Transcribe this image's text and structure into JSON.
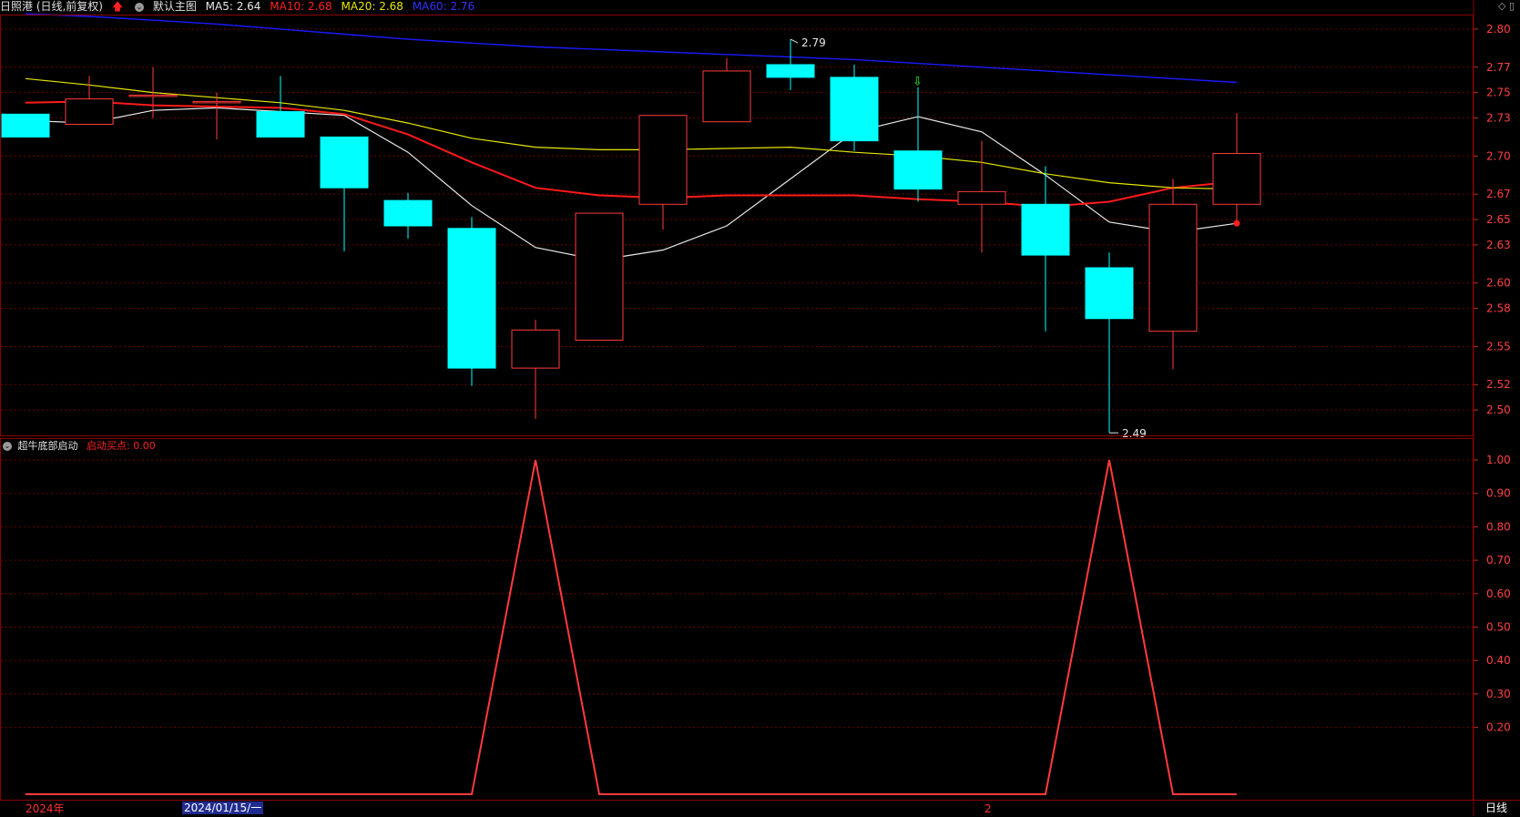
{
  "header": {
    "stock": "日照港 (日线,前复权)",
    "template": "默认主图",
    "ma5": "MA5: 2.64",
    "ma10": "MA10: 2.68",
    "ma20": "MA20: 2.68",
    "ma60": "MA60: 2.76"
  },
  "indicator": {
    "name": "超牛底部启动",
    "value_label": "启动买点: 0.00"
  },
  "bottom": {
    "year_label": "2024年",
    "cursor_date": "2024/01/15/一",
    "month_label": "2",
    "period": "日线"
  },
  "colors": {
    "up": "#ff3b3b",
    "down": "#00ffff",
    "ma5": "#e8e8e8",
    "ma10": "#ff1a1a",
    "ma20": "#e6e600",
    "ma60": "#1a1aff",
    "grid": "#6b0000",
    "axis_text": "#ff4040"
  },
  "chart_data": [
    {
      "type": "candlestick",
      "y_ticks": [
        "2.80",
        "2.77",
        "2.75",
        "2.73",
        "2.70",
        "2.67",
        "2.65",
        "2.63",
        "2.60",
        "2.58",
        "2.55",
        "2.52",
        "2.50"
      ],
      "ylim": [
        2.48,
        2.81
      ],
      "annotations": {
        "high": "2.79",
        "low": "2.49"
      },
      "candles": [
        {
          "o": 2.733,
          "c": 2.715,
          "h": 2.733,
          "l": 2.715
        },
        {
          "o": 2.725,
          "c": 2.745,
          "h": 2.763,
          "l": 2.725
        },
        {
          "o": 2.748,
          "c": 2.748,
          "h": 2.77,
          "l": 2.73
        },
        {
          "o": 2.743,
          "c": 2.743,
          "h": 2.75,
          "l": 2.713
        },
        {
          "o": 2.735,
          "c": 2.715,
          "h": 2.763,
          "l": 2.715
        },
        {
          "o": 2.715,
          "c": 2.675,
          "h": 2.715,
          "l": 2.625
        },
        {
          "o": 2.665,
          "c": 2.645,
          "h": 2.671,
          "l": 2.635
        },
        {
          "o": 2.643,
          "c": 2.533,
          "h": 2.652,
          "l": 2.519
        },
        {
          "o": 2.533,
          "c": 2.563,
          "h": 2.571,
          "l": 2.493
        },
        {
          "o": 2.555,
          "c": 2.655,
          "h": 2.655,
          "l": 2.555
        },
        {
          "o": 2.662,
          "c": 2.732,
          "h": 2.732,
          "l": 2.642
        },
        {
          "o": 2.727,
          "c": 2.767,
          "h": 2.777,
          "l": 2.727
        },
        {
          "o": 2.772,
          "c": 2.762,
          "h": 2.792,
          "l": 2.752
        },
        {
          "o": 2.762,
          "c": 2.712,
          "h": 2.772,
          "l": 2.704
        },
        {
          "o": 2.704,
          "c": 2.674,
          "h": 2.754,
          "l": 2.664
        },
        {
          "o": 2.662,
          "c": 2.672,
          "h": 2.712,
          "l": 2.624
        },
        {
          "o": 2.662,
          "c": 2.622,
          "h": 2.692,
          "l": 2.562
        },
        {
          "o": 2.612,
          "c": 2.572,
          "h": 2.624,
          "l": 2.482
        },
        {
          "o": 2.562,
          "c": 2.662,
          "h": 2.682,
          "l": 2.532
        },
        {
          "o": 2.662,
          "c": 2.702,
          "h": 2.734,
          "l": 2.647
        }
      ],
      "series": [
        {
          "name": "MA5",
          "values": [
            2.728,
            2.726,
            2.736,
            2.738,
            2.735,
            2.732,
            2.703,
            2.661,
            2.628,
            2.618,
            2.626,
            2.645,
            2.682,
            2.719,
            2.731,
            2.719,
            2.685,
            2.648,
            2.64,
            2.647
          ]
        },
        {
          "name": "MA10",
          "values": [
            2.742,
            2.743,
            2.74,
            2.739,
            2.738,
            2.733,
            2.717,
            2.695,
            2.675,
            2.669,
            2.667,
            2.669,
            2.669,
            2.669,
            2.666,
            2.664,
            2.66,
            2.664,
            2.675,
            2.68
          ]
        },
        {
          "name": "MA20",
          "values": [
            2.761,
            2.756,
            2.75,
            2.746,
            2.742,
            2.736,
            2.726,
            2.714,
            2.707,
            2.705,
            2.705,
            2.706,
            2.707,
            2.703,
            2.7,
            2.695,
            2.686,
            2.679,
            2.675,
            2.674
          ]
        },
        {
          "name": "MA60",
          "values": [
            2.812,
            2.81,
            2.807,
            2.804,
            2.8,
            2.796,
            2.792,
            2.789,
            2.786,
            2.784,
            2.782,
            2.78,
            2.778,
            2.776,
            2.773,
            2.77,
            2.767,
            2.764,
            2.761,
            2.758
          ]
        }
      ]
    },
    {
      "type": "line",
      "y_ticks": [
        "1.00",
        "0.90",
        "0.80",
        "0.70",
        "0.60",
        "0.50",
        "0.40",
        "0.30",
        "0.20"
      ],
      "ylim": [
        0,
        1
      ],
      "series": [
        {
          "name": "启动买点",
          "values": [
            0,
            0,
            0,
            0,
            0,
            0,
            0,
            0,
            1,
            0,
            0,
            0,
            0,
            0,
            0,
            0,
            0,
            1,
            0,
            0
          ]
        }
      ]
    }
  ]
}
